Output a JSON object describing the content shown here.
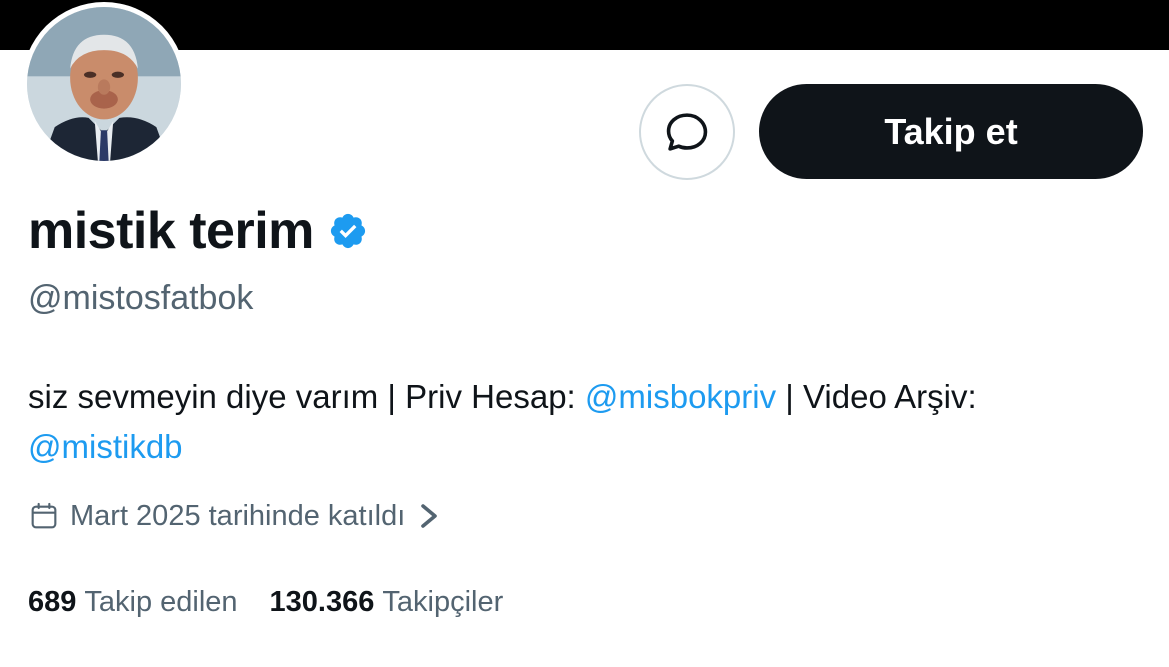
{
  "colors": {
    "text_primary": "#0f1419",
    "text_secondary": "#536471",
    "link": "#1d9bf0",
    "verified_badge": "#1d9bf0",
    "follow_button_bg": "#0f1419",
    "banner": "#000000"
  },
  "profile": {
    "display_name": "mistik terim",
    "handle": "@mistosfatbok",
    "verified": true,
    "avatar_icon": "profile-photo"
  },
  "actions": {
    "message_icon": "message-bubble-icon",
    "follow_label": "Takip et"
  },
  "bio": {
    "text_1": "siz sevmeyin diye varım | Priv Hesap: ",
    "link_1": "@misbokpriv",
    "text_2": " | Video Arşiv: ",
    "link_2": "@mistikdb"
  },
  "joined": {
    "icon": "calendar-icon",
    "text": "Mart 2025 tarihinde katıldı"
  },
  "stats": {
    "following_count": "689",
    "following_label": "Takip edilen",
    "followers_count": "130.366",
    "followers_label": "Takipçiler"
  }
}
